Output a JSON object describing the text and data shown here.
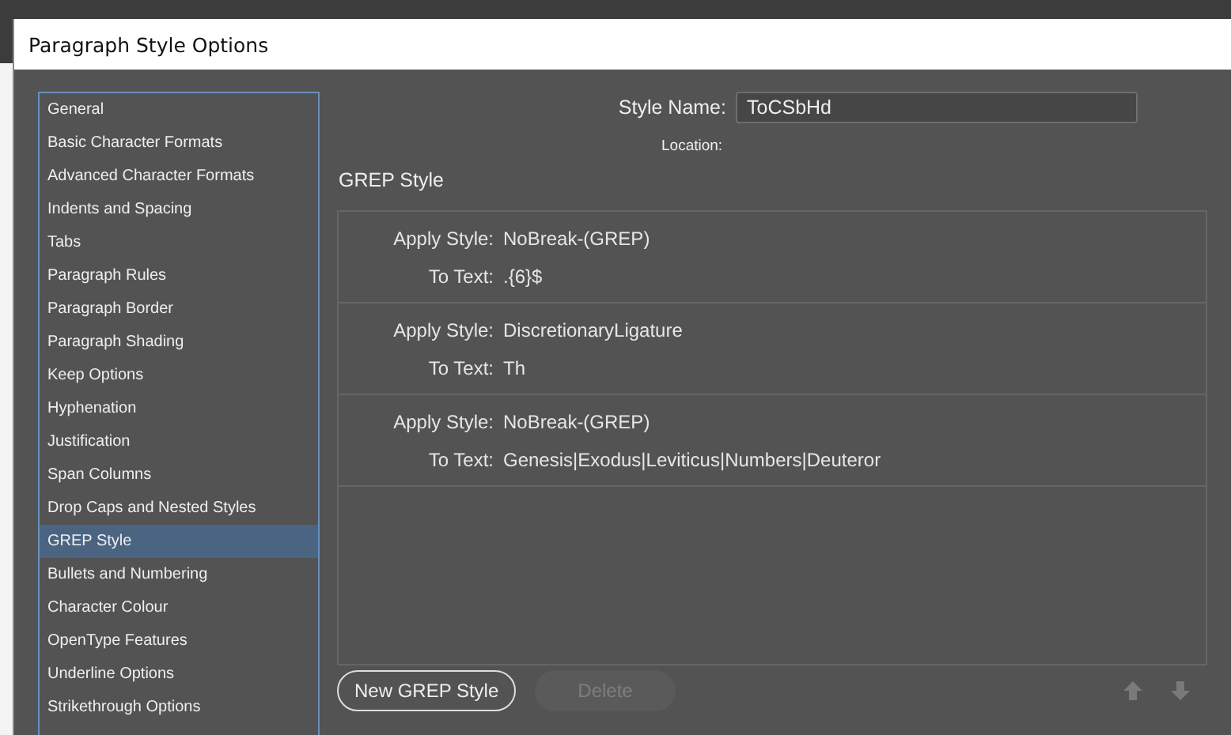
{
  "window": {
    "title": "Paragraph Style Options"
  },
  "sidebar": {
    "items": [
      {
        "label": "General",
        "selected": false
      },
      {
        "label": "Basic Character Formats",
        "selected": false
      },
      {
        "label": "Advanced Character Formats",
        "selected": false
      },
      {
        "label": "Indents and Spacing",
        "selected": false
      },
      {
        "label": "Tabs",
        "selected": false
      },
      {
        "label": "Paragraph Rules",
        "selected": false
      },
      {
        "label": "Paragraph Border",
        "selected": false
      },
      {
        "label": "Paragraph Shading",
        "selected": false
      },
      {
        "label": "Keep Options",
        "selected": false
      },
      {
        "label": "Hyphenation",
        "selected": false
      },
      {
        "label": "Justification",
        "selected": false
      },
      {
        "label": "Span Columns",
        "selected": false
      },
      {
        "label": "Drop Caps and Nested Styles",
        "selected": false
      },
      {
        "label": "GREP Style",
        "selected": true
      },
      {
        "label": "Bullets and Numbering",
        "selected": false
      },
      {
        "label": "Character Colour",
        "selected": false
      },
      {
        "label": "OpenType Features",
        "selected": false
      },
      {
        "label": "Underline Options",
        "selected": false
      },
      {
        "label": "Strikethrough Options",
        "selected": false
      }
    ]
  },
  "style_name": {
    "label": "Style Name:",
    "value": "ToCSbHd"
  },
  "location": {
    "label": "Location:"
  },
  "section_title": "GREP Style",
  "grep_rules": [
    {
      "apply_label": "Apply Style:",
      "apply_value": "NoBreak-(GREP)",
      "text_label": "To Text:",
      "text_value": ".{6}$"
    },
    {
      "apply_label": "Apply Style:",
      "apply_value": "DiscretionaryLigature",
      "text_label": "To Text:",
      "text_value": "Th"
    },
    {
      "apply_label": "Apply Style:",
      "apply_value": "NoBreak-(GREP)",
      "text_label": "To Text:",
      "text_value": "Genesis|Exodus|Leviticus|Numbers|Deuteror"
    }
  ],
  "buttons": [
    {
      "label": "New GREP Style",
      "disabled": false
    },
    {
      "label": "Delete",
      "disabled": true
    }
  ],
  "move_buttons": {
    "up_disabled": true,
    "down_disabled": true
  }
}
